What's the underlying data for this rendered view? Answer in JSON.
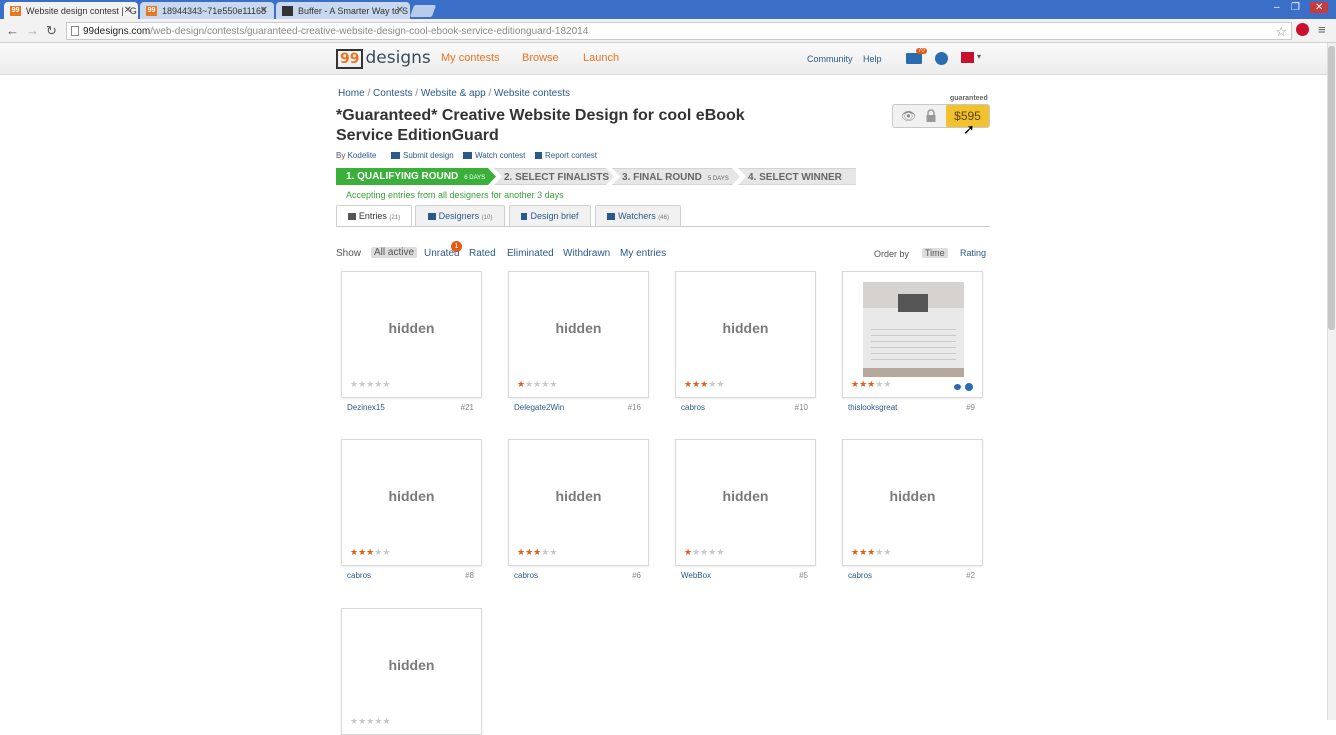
{
  "browser": {
    "tabs": [
      {
        "label": "Website design contest | *G",
        "favicon": "99",
        "active": true
      },
      {
        "label": "18944343~71e550e11168",
        "favicon": "99",
        "active": false
      },
      {
        "label": "Buffer - A Smarter Way to S",
        "favicon": "buffer-icon",
        "active": false
      }
    ],
    "url_host": "99designs.com",
    "url_path": "/web-design/contests/guaranteed-creative-website-design-cool-ebook-service-editionguard-182014"
  },
  "site": {
    "logo_num": "99",
    "logo_word": "designs",
    "nav": [
      "My contests",
      "Browse",
      "Launch"
    ],
    "right_nav": [
      "Community",
      "Help"
    ],
    "mail_count": "70",
    "accent": "#e87722"
  },
  "contest": {
    "breadcrumb": [
      "Home",
      "Contests",
      "Website & app",
      "Website contests"
    ],
    "title": "*Guaranteed* Creative Website Design for cool eBook Service EditionGuard",
    "by_label": "By",
    "owner": "Kodelite",
    "actions": [
      "Submit design",
      "Watch contest",
      "Report contest"
    ],
    "guaranteed_label": "guaranteed",
    "prize": "$595",
    "steps": [
      {
        "label": "1. QUALIFYING ROUND",
        "sub": "6 DAYS"
      },
      {
        "label": "2. SELECT FINALISTS",
        "sub": ""
      },
      {
        "label": "3. FINAL ROUND",
        "sub": "5 DAYS"
      },
      {
        "label": "4. SELECT WINNER",
        "sub": ""
      }
    ],
    "accept_message": "Accepting entries from all designers for another 3 days",
    "tabs": [
      {
        "label": "Entries",
        "count": "(21)"
      },
      {
        "label": "Designers",
        "count": "(10)"
      },
      {
        "label": "Design brief",
        "count": ""
      },
      {
        "label": "Watchers",
        "count": "(46)"
      }
    ]
  },
  "filters": {
    "show_label": "Show",
    "items": [
      "All active",
      "Unrated",
      "Rated",
      "Eliminated",
      "Withdrawn",
      "My entries"
    ],
    "unrated_badge": "1",
    "order_label": "Order by",
    "order_items": [
      "Time",
      "Rating"
    ]
  },
  "entries": [
    {
      "hidden": "hidden",
      "designer": "Dezinex15",
      "num": "#21",
      "rating": 0
    },
    {
      "hidden": "hidden",
      "designer": "Delegate2Win",
      "num": "#16",
      "rating": 1
    },
    {
      "hidden": "hidden",
      "designer": "cabros",
      "num": "#10",
      "rating": 3
    },
    {
      "hidden": "",
      "designer": "thislooksgreat",
      "num": "#9",
      "rating": 3
    },
    {
      "hidden": "hidden",
      "designer": "cabros",
      "num": "#8",
      "rating": 3
    },
    {
      "hidden": "hidden",
      "designer": "cabros",
      "num": "#6",
      "rating": 3
    },
    {
      "hidden": "hidden",
      "designer": "WebBox",
      "num": "#5",
      "rating": 1
    },
    {
      "hidden": "hidden",
      "designer": "cabros",
      "num": "#2",
      "rating": 3
    },
    {
      "hidden": "hidden",
      "designer": "",
      "num": "",
      "rating": 0
    }
  ]
}
